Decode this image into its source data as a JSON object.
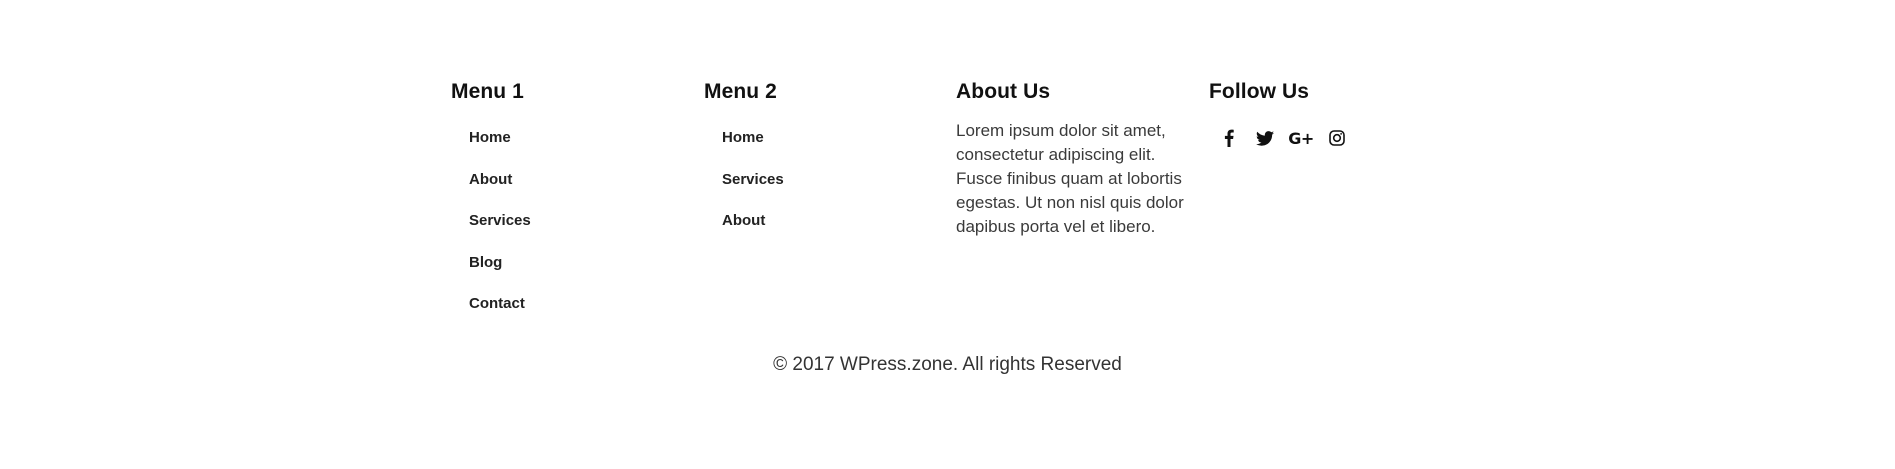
{
  "menu1": {
    "title": "Menu 1",
    "items": [
      {
        "label": "Home"
      },
      {
        "label": "About"
      },
      {
        "label": "Services"
      },
      {
        "label": "Blog"
      },
      {
        "label": "Contact"
      }
    ]
  },
  "menu2": {
    "title": "Menu 2",
    "items": [
      {
        "label": "Home"
      },
      {
        "label": "Services"
      },
      {
        "label": "About"
      }
    ]
  },
  "about": {
    "title": "About Us",
    "text": "Lorem ipsum dolor sit amet, consectetur adipiscing elit. Fusce finibus quam at lobortis egestas. Ut non nisl quis dolor dapibus porta vel et libero."
  },
  "follow": {
    "title": "Follow Us",
    "icons": [
      {
        "name": "facebook-icon"
      },
      {
        "name": "twitter-icon"
      },
      {
        "name": "google-plus-icon",
        "glyph": "G+"
      },
      {
        "name": "instagram-icon"
      }
    ]
  },
  "copyright": "© 2017 WPress.zone. All rights Reserved",
  "colors": {
    "text": "#222222",
    "background": "#ffffff"
  }
}
